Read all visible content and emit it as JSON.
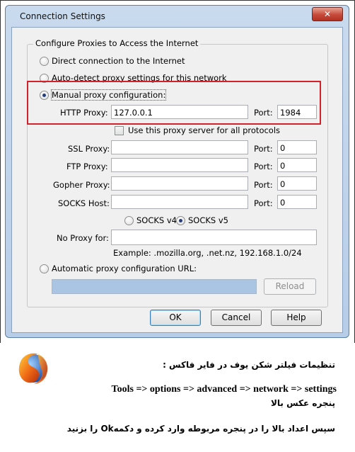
{
  "window": {
    "title": "Connection Settings",
    "close_glyph": "✕"
  },
  "group": {
    "legend": "Configure Proxies to Access the Internet"
  },
  "options": {
    "direct": "Direct connection to the Internet",
    "auto_detect": "Auto-detect proxy settings for this network",
    "manual": "Manual proxy configuration:",
    "auto_url": "Automatic proxy configuration URL:"
  },
  "http": {
    "label": "HTTP Proxy:",
    "value": "127.0.0.1",
    "port_label": "Port:",
    "port": "1984"
  },
  "use_all": {
    "label": "Use this proxy server for all protocols",
    "checked": false
  },
  "ssl": {
    "label": "SSL Proxy:",
    "value": "",
    "port_label": "Port:",
    "port": "0"
  },
  "ftp": {
    "label": "FTP Proxy:",
    "value": "",
    "port_label": "Port:",
    "port": "0"
  },
  "gopher": {
    "label": "Gopher Proxy:",
    "value": "",
    "port_label": "Port:",
    "port": "0"
  },
  "socks": {
    "label": "SOCKS Host:",
    "value": "",
    "port_label": "Port:",
    "port": "0",
    "v4": "SOCKS v4",
    "v5": "SOCKS v5"
  },
  "noproxy": {
    "label": "No Proxy for:",
    "value": "",
    "example": "Example: .mozilla.org, .net.nz, 192.168.1.0/24"
  },
  "auto_url": {
    "value": "",
    "reload": "Reload"
  },
  "buttons": {
    "ok": "OK",
    "cancel": "Cancel",
    "help": "Help"
  },
  "caption": {
    "line1": "تنظیمات فیلتر شکن یوف در فایر فاکس :",
    "line2": "Tools => options => advanced => network => settings",
    "line3": "پنجره عکس بالا",
    "line4": "سپس اعداد بالا را در پنجره مربوطه وارد کرده و دکمهOk را بزنید"
  },
  "colors": {
    "highlight": "#d3222a",
    "titlebar": "#c9daee",
    "close_button": "#c6493a"
  }
}
